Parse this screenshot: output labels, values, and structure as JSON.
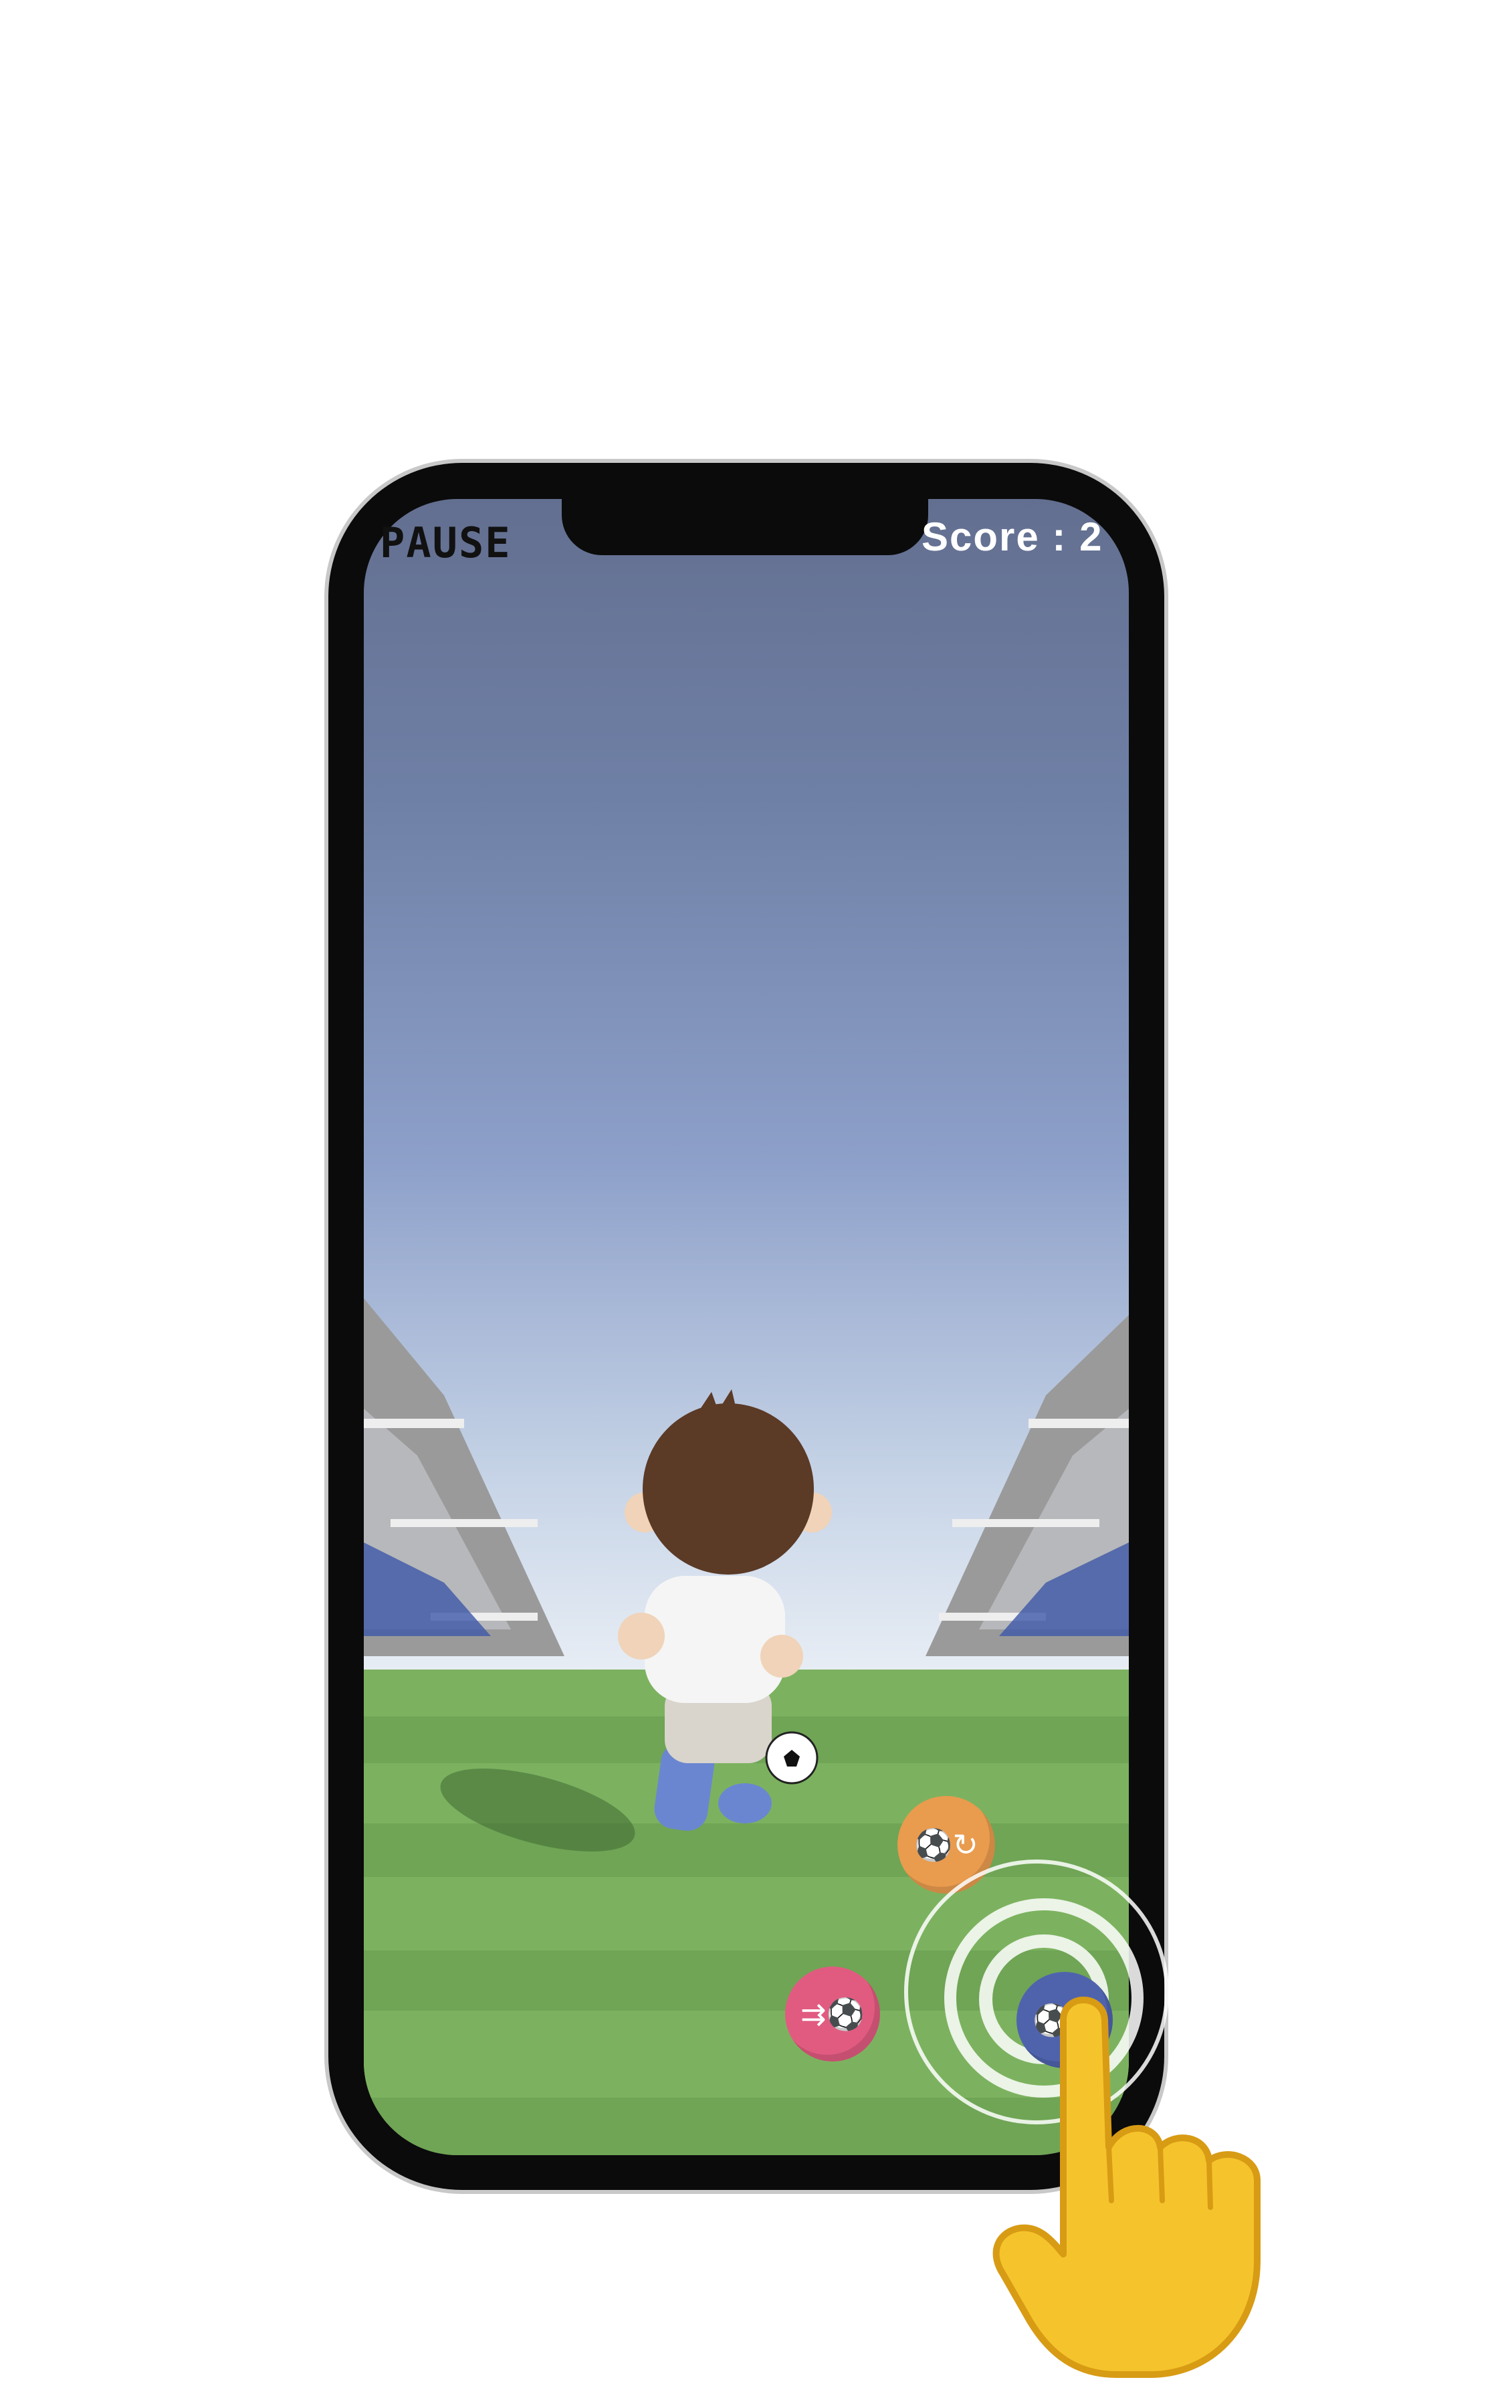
{
  "hud": {
    "pause_label": "PAUSE",
    "score_label": "Score : 2"
  },
  "controls": {
    "skill_icon": "ball-swap-icon",
    "dribble_icon": "ball-dash-icon",
    "shoot_icon": "ball-kick-icon"
  },
  "colors": {
    "sky_top": "#636f90",
    "pitch_green": "#6fa555",
    "skill_button": "#e99b4e",
    "dribble_button": "#e15b80",
    "shoot_button": "#4f63ad"
  }
}
